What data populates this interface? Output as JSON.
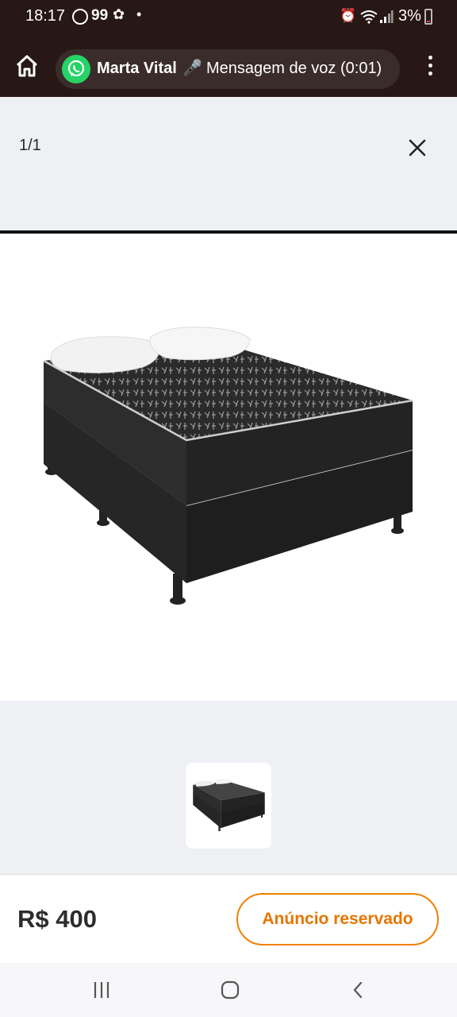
{
  "status_bar": {
    "time": "18:17",
    "app_badge": "99",
    "battery": "3%",
    "icons": [
      "whatsapp-icon",
      "flower-icon",
      "dot-icon",
      "alarm-icon",
      "wifi-icon",
      "signal-icon",
      "battery-icon"
    ]
  },
  "call_bar": {
    "contact": "Marta Vital",
    "voice_label": "Mensagem de voz (0:01)",
    "icons": [
      "home-icon",
      "whatsapp-icon",
      "microphone-icon",
      "more-vert-icon"
    ]
  },
  "viewer": {
    "counter": "1/1",
    "image_subject": "bed-photo",
    "icons": [
      "close-icon"
    ]
  },
  "listing": {
    "price": "R$ 400",
    "status_button": "Anúncio reservado"
  },
  "colors": {
    "status_bg": "#271715",
    "pill_bg": "#3a2c2a",
    "whatsapp_green": "#25d366",
    "accent_orange": "#f28000",
    "page_bg": "#eef0f4"
  },
  "nav_bar": {
    "icons": [
      "recents-icon",
      "home-circle-icon",
      "back-icon"
    ]
  }
}
